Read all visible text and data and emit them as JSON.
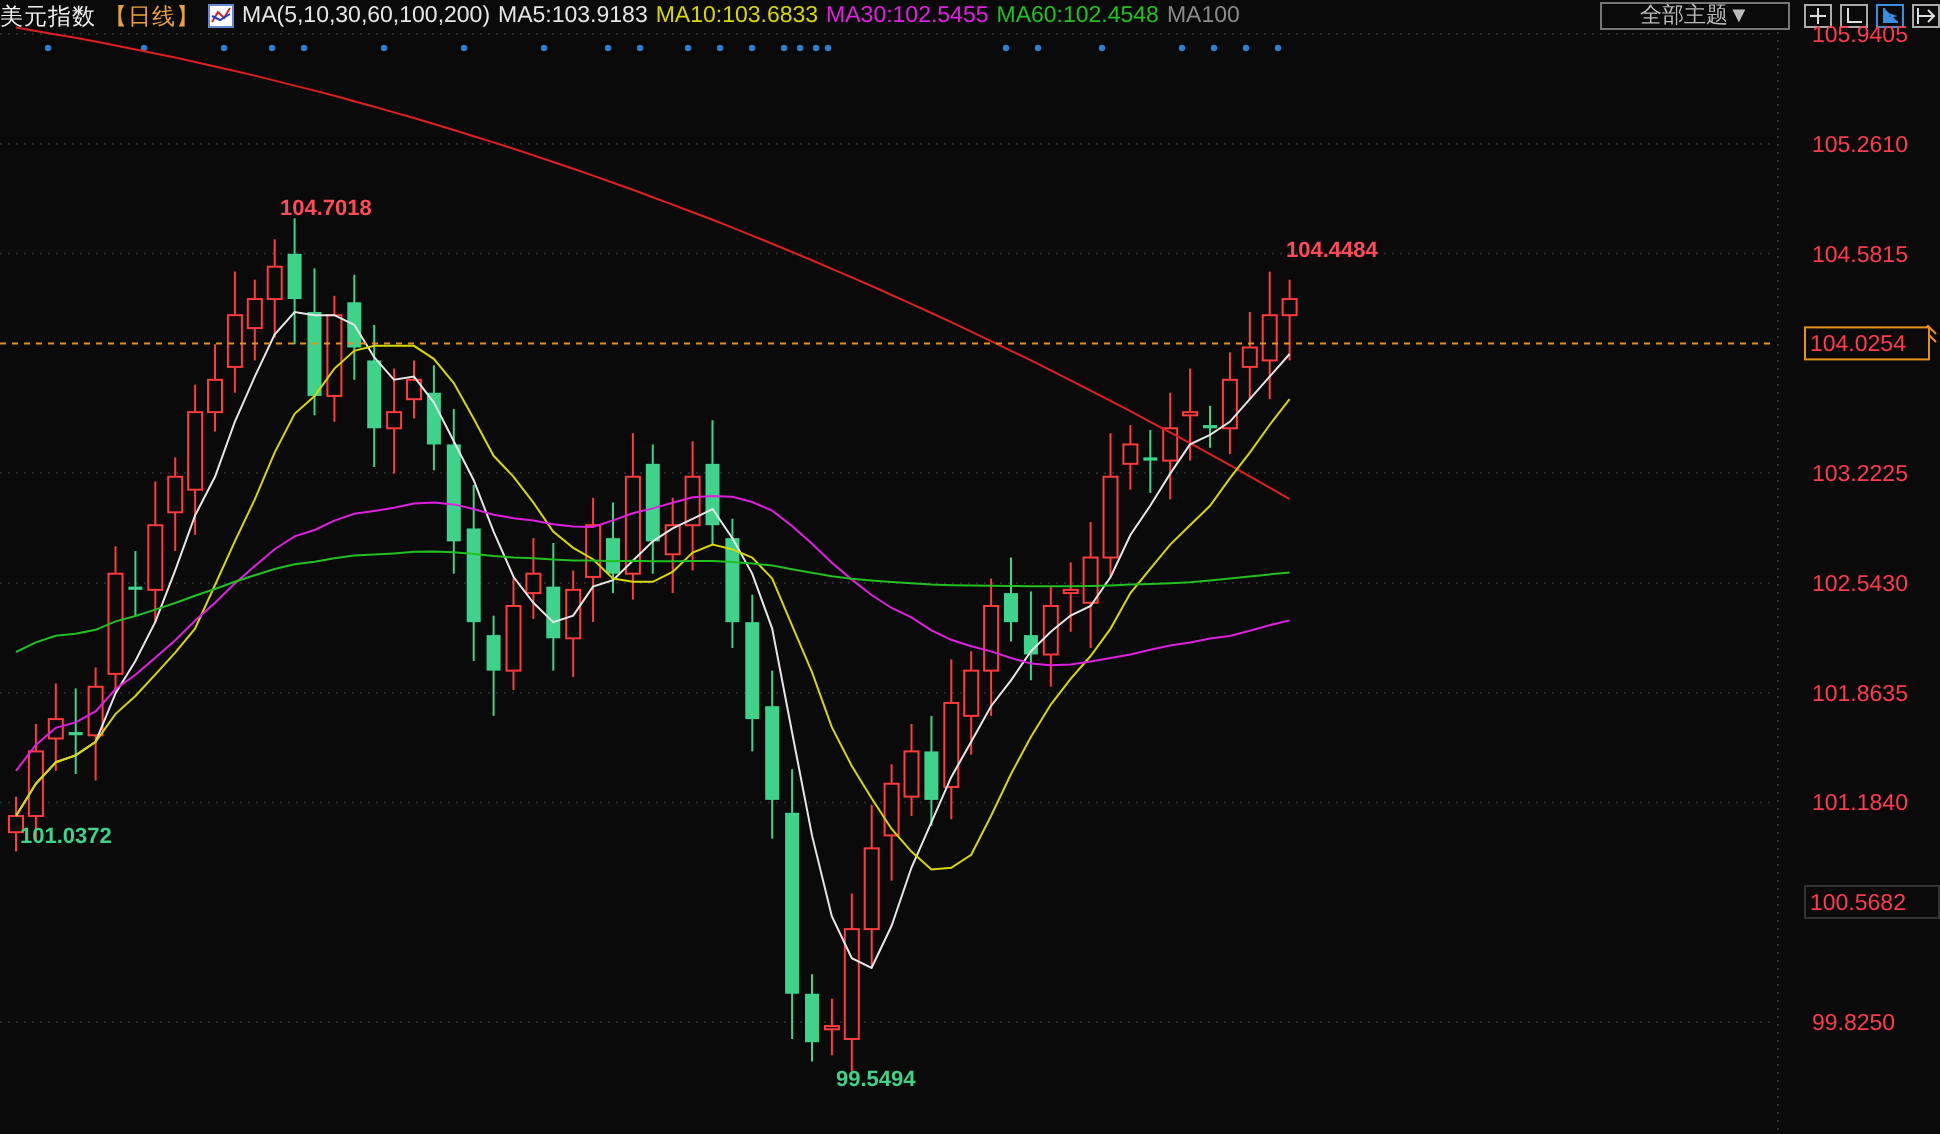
{
  "header": {
    "title": "美元指数",
    "period": "【日线】",
    "ma_params": "MA(5,10,30,60,100,200)",
    "ma_values": [
      {
        "text": "MA5:103.9183",
        "color": "#e6e6e6"
      },
      {
        "text": "MA10:103.6833",
        "color": "#d8d800"
      },
      {
        "text": "MA30:102.5455",
        "color": "#e020e0"
      },
      {
        "text": "MA60:102.4548",
        "color": "#22c022"
      },
      {
        "text": "MA100",
        "color": "#8a8a8a"
      }
    ],
    "theme_button": "全部主题▼"
  },
  "chart": {
    "price_axis": [
      "105.9405",
      "105.2610",
      "104.5815",
      "103.2225",
      "102.5430",
      "101.8635",
      "101.1840",
      "99.8250"
    ],
    "current_price": "104.0254",
    "marked_price": "100.5682",
    "annotations": [
      {
        "text": "104.7018",
        "kind": "high"
      },
      {
        "text": "104.4484",
        "kind": "high"
      },
      {
        "text": "101.0372",
        "kind": "low"
      },
      {
        "text": "99.5494",
        "kind": "low"
      }
    ]
  }
}
